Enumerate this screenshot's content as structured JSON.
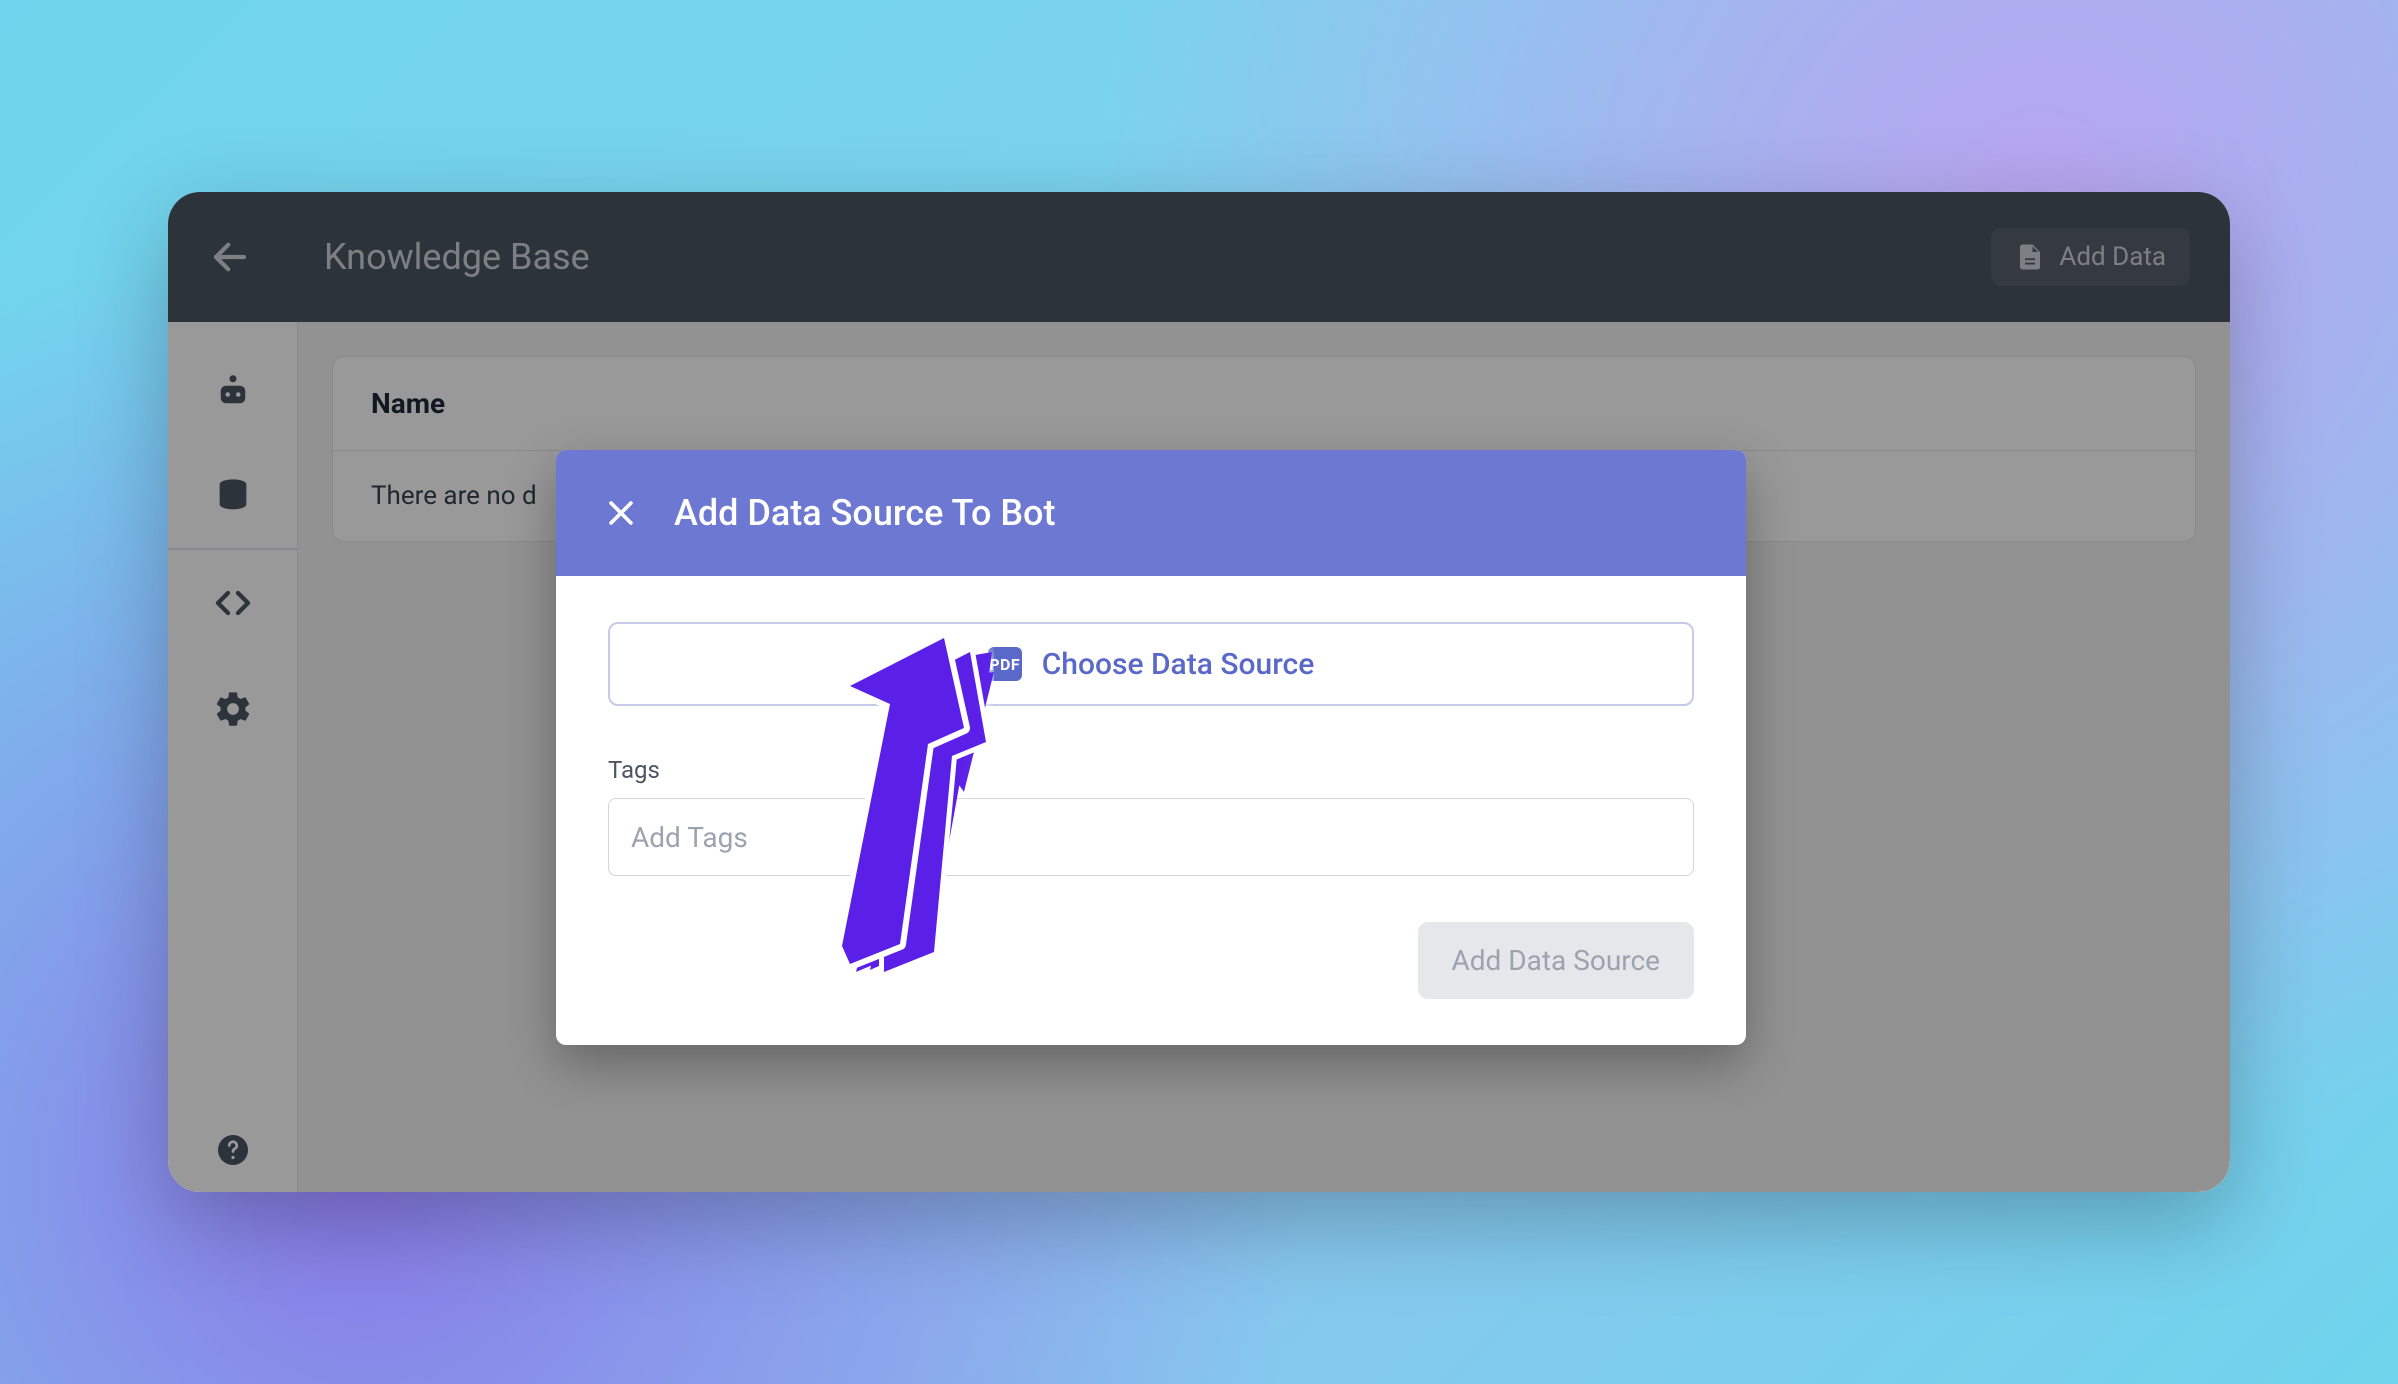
{
  "header": {
    "title": "Knowledge Base",
    "add_data_label": "Add Data"
  },
  "sidebar": {
    "icons": [
      "robot",
      "database",
      "code",
      "settings"
    ],
    "help_icon": "help"
  },
  "table": {
    "column_name": "Name",
    "empty_text": "There are no d"
  },
  "modal": {
    "title": "Add Data Source To Bot",
    "choose_label": "Choose Data Source",
    "pdf_badge": "PDF",
    "tags_label": "Tags",
    "tags_placeholder": "Add Tags",
    "submit_label": "Add Data Source"
  }
}
